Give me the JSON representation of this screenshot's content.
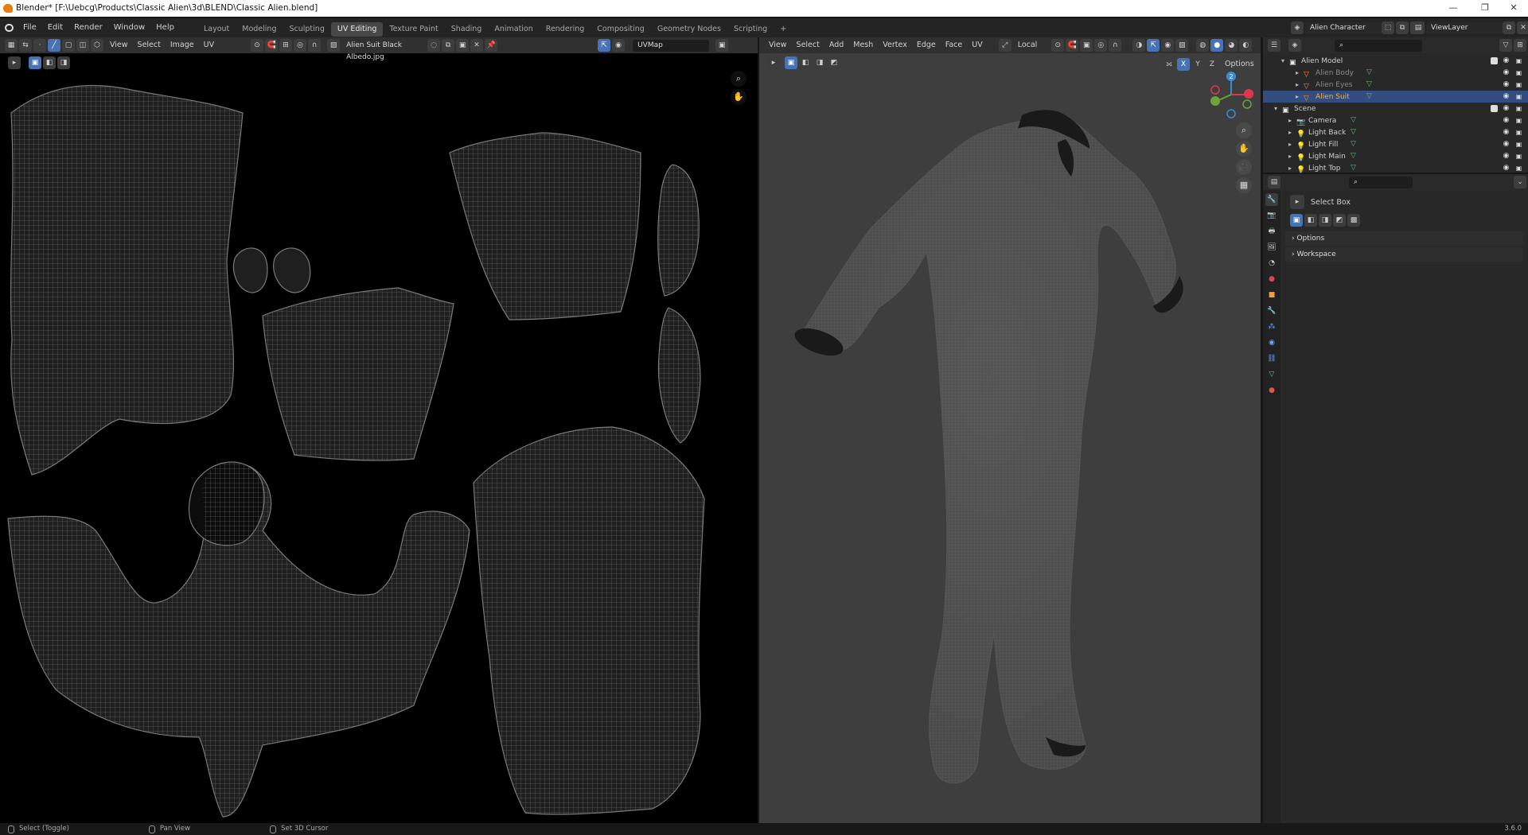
{
  "window": {
    "title": "Blender* [F:\\Uebcg\\Products\\Classic Alien\\3d\\BLEND\\Classic Alien.blend]",
    "min": "—",
    "max": "❐",
    "close": "✕"
  },
  "menubar": {
    "items": [
      "File",
      "Edit",
      "Render",
      "Window",
      "Help"
    ],
    "workspaces": [
      {
        "label": "Layout"
      },
      {
        "label": "Modeling"
      },
      {
        "label": "Sculpting"
      },
      {
        "label": "UV Editing",
        "active": true
      },
      {
        "label": "Texture Paint"
      },
      {
        "label": "Shading"
      },
      {
        "label": "Animation"
      },
      {
        "label": "Rendering"
      },
      {
        "label": "Compositing"
      },
      {
        "label": "Geometry Nodes"
      },
      {
        "label": "Scripting"
      }
    ],
    "add_workspace": "+",
    "scene_name": "Alien Character",
    "view_layer": "ViewLayer"
  },
  "uv_editor": {
    "menus": [
      "View",
      "Select",
      "Image",
      "UV"
    ],
    "image_name": "Alien Suit Black Albedo.jpg",
    "uv_map": "UVMap"
  },
  "viewport": {
    "menus": [
      "View",
      "Select",
      "Add",
      "Mesh",
      "Vertex",
      "Edge",
      "Face",
      "UV"
    ],
    "orientation": "Local",
    "options_label": "Options",
    "axes": [
      "X",
      "Y",
      "Z"
    ],
    "gizmo": {
      "x_color": "#e0364d",
      "y_color": "#6ca33a",
      "z_color": "#3c8ad6",
      "z_label": "2"
    }
  },
  "outliner": {
    "search_placeholder": "",
    "rows": [
      {
        "label": "Alien Model",
        "type": "collection",
        "indent": 1,
        "expand": "▾"
      },
      {
        "label": "Alien Body",
        "type": "mesh",
        "indent": 3,
        "expand": "▸",
        "dim": true
      },
      {
        "label": "Alien Eyes",
        "type": "mesh",
        "indent": 3,
        "expand": "▸",
        "dim": true
      },
      {
        "label": "Alien Suit",
        "type": "mesh",
        "indent": 3,
        "expand": "▸",
        "selected": true
      },
      {
        "label": "Scene",
        "type": "collection",
        "indent": 0,
        "expand": "▾"
      },
      {
        "label": "Camera",
        "type": "camera",
        "indent": 2,
        "expand": "▸"
      },
      {
        "label": "Light Back",
        "type": "light",
        "indent": 2,
        "expand": "▸"
      },
      {
        "label": "Light Fill",
        "type": "light",
        "indent": 2,
        "expand": "▸"
      },
      {
        "label": "Light Main",
        "type": "light",
        "indent": 2,
        "expand": "▸"
      },
      {
        "label": "Light Top",
        "type": "light",
        "indent": 2,
        "expand": "▸"
      }
    ]
  },
  "properties": {
    "tool_name": "Select Box",
    "panels": [
      "Options",
      "Workspace"
    ]
  },
  "statusbar": {
    "items": [
      {
        "icon": "mouse-left-icon",
        "label": "Select (Toggle)"
      },
      {
        "icon": "mouse-middle-icon",
        "label": "Pan View"
      },
      {
        "icon": "mouse-right-icon",
        "label": "Set 3D Cursor"
      }
    ],
    "version": "3.6.0"
  },
  "colors": {
    "accent": "#4772b3",
    "selection": "#334d80",
    "active_object": "#ffaf29",
    "mesh_icon": "#ff8c3a",
    "light_icon": "#f0a030",
    "data_green": "#5dbf7a"
  }
}
